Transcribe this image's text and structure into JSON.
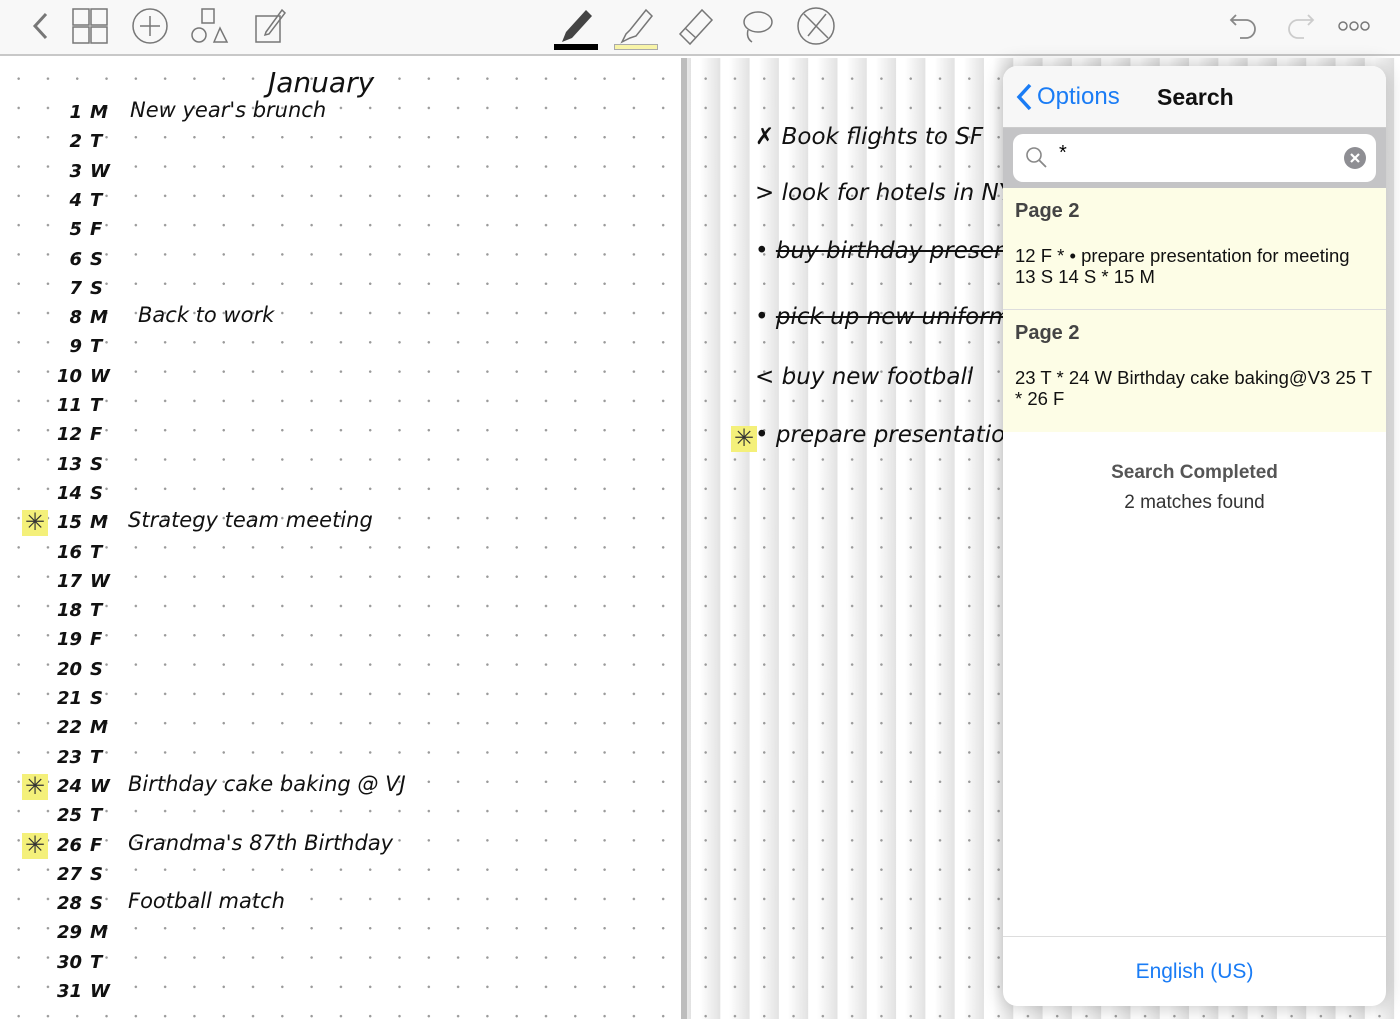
{
  "toolbar": {
    "icons": [
      "back-chevron-icon",
      "grid-icon",
      "add-icon",
      "shapes-icon",
      "edit-icon",
      "pen-icon",
      "highlighter-icon",
      "eraser-icon",
      "lasso-icon",
      "no-pen-icon",
      "undo-icon",
      "redo-icon",
      "more-icon"
    ],
    "pen_color": "#000000",
    "highlighter_color": "#f8f4a8"
  },
  "left_page": {
    "title": "January",
    "days": [
      {
        "n": "1",
        "d": "M",
        "note": "New year's brunch"
      },
      {
        "n": "2",
        "d": "T"
      },
      {
        "n": "3",
        "d": "W"
      },
      {
        "n": "4",
        "d": "T"
      },
      {
        "n": "5",
        "d": "F"
      },
      {
        "n": "6",
        "d": "S"
      },
      {
        "n": "7",
        "d": "S"
      },
      {
        "n": "8",
        "d": "M",
        "note": "Back to work"
      },
      {
        "n": "9",
        "d": "T"
      },
      {
        "n": "10",
        "d": "W"
      },
      {
        "n": "11",
        "d": "T"
      },
      {
        "n": "12",
        "d": "F"
      },
      {
        "n": "13",
        "d": "S"
      },
      {
        "n": "14",
        "d": "S"
      },
      {
        "n": "15",
        "d": "M",
        "note": "Strategy team meeting",
        "star": true
      },
      {
        "n": "16",
        "d": "T"
      },
      {
        "n": "17",
        "d": "W"
      },
      {
        "n": "18",
        "d": "T"
      },
      {
        "n": "19",
        "d": "F"
      },
      {
        "n": "20",
        "d": "S"
      },
      {
        "n": "21",
        "d": "S"
      },
      {
        "n": "22",
        "d": "M"
      },
      {
        "n": "23",
        "d": "T"
      },
      {
        "n": "24",
        "d": "W",
        "note": "Birthday cake baking @ VJ",
        "star": true
      },
      {
        "n": "25",
        "d": "T"
      },
      {
        "n": "26",
        "d": "F",
        "note": "Grandma's 87th Birthday",
        "star": true
      },
      {
        "n": "27",
        "d": "S"
      },
      {
        "n": "28",
        "d": "S",
        "note": "Football match"
      },
      {
        "n": "29",
        "d": "M"
      },
      {
        "n": "30",
        "d": "T"
      },
      {
        "n": "31",
        "d": "W"
      }
    ]
  },
  "right_page": {
    "tasks": [
      {
        "mark": "✗",
        "text": "Book flights to SF"
      },
      {
        "mark": ">",
        "text": "look for hotels in NY"
      },
      {
        "mark": "•",
        "text": "buy birthday present",
        "done": true
      },
      {
        "mark": "•",
        "text": "pick up new uniform",
        "done": true
      },
      {
        "mark": "<",
        "text": "buy new football"
      },
      {
        "mark": "•",
        "text": "prepare presentation",
        "star": true
      }
    ]
  },
  "search_panel": {
    "back_label": "Options",
    "title": "Search",
    "query": "*",
    "results": [
      {
        "page": "Page 2",
        "snippet": "12 F * • prepare presentation for meeting 13 S 14 S * 15 M"
      },
      {
        "page": "Page 2",
        "snippet": "23 T * 24 W Birthday cake baking@V3 25 T * 26 F"
      }
    ],
    "status_title": "Search Completed",
    "status_count": "2 matches found",
    "language": "English (US)"
  }
}
